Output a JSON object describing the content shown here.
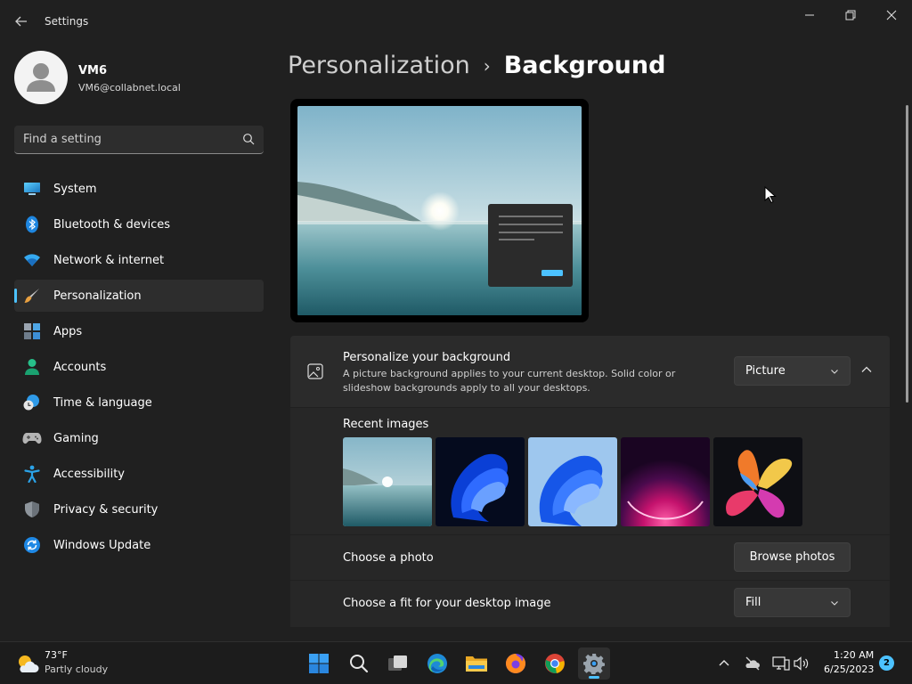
{
  "window": {
    "title": "Settings"
  },
  "profile": {
    "name": "VM6",
    "email": "VM6@collabnet.local"
  },
  "search": {
    "placeholder": "Find a setting"
  },
  "nav": {
    "items": [
      {
        "label": "System",
        "icon": "monitor-icon"
      },
      {
        "label": "Bluetooth & devices",
        "icon": "bluetooth-icon"
      },
      {
        "label": "Network & internet",
        "icon": "wifi-icon"
      },
      {
        "label": "Personalization",
        "icon": "brush-icon",
        "active": true
      },
      {
        "label": "Apps",
        "icon": "apps-icon"
      },
      {
        "label": "Accounts",
        "icon": "person-icon"
      },
      {
        "label": "Time & language",
        "icon": "clock-globe-icon"
      },
      {
        "label": "Gaming",
        "icon": "gamepad-icon"
      },
      {
        "label": "Accessibility",
        "icon": "accessibility-icon"
      },
      {
        "label": "Privacy & security",
        "icon": "shield-icon"
      },
      {
        "label": "Windows Update",
        "icon": "update-icon"
      }
    ]
  },
  "header": {
    "parent": "Personalization",
    "current": "Background"
  },
  "background_card": {
    "title": "Personalize your background",
    "description": "A picture background applies to your current desktop. Solid color or slideshow backgrounds apply to all your desktops.",
    "type_value": "Picture"
  },
  "recent": {
    "label": "Recent images",
    "images": [
      "lake-landscape",
      "blue-bloom-dark",
      "blue-bloom-light",
      "purple-glow",
      "colorful-flower"
    ]
  },
  "photo_row": {
    "label": "Choose a photo",
    "button": "Browse photos"
  },
  "fit_row": {
    "label": "Choose a fit for your desktop image",
    "value": "Fill"
  },
  "taskbar": {
    "weather_temp": "73°F",
    "weather_condition": "Partly cloudy",
    "time": "1:20 AM",
    "date": "6/25/2023",
    "notifications": "2"
  },
  "colors": {
    "accent": "#4cc2ff",
    "background": "#202020",
    "card": "#2b2b2b"
  }
}
